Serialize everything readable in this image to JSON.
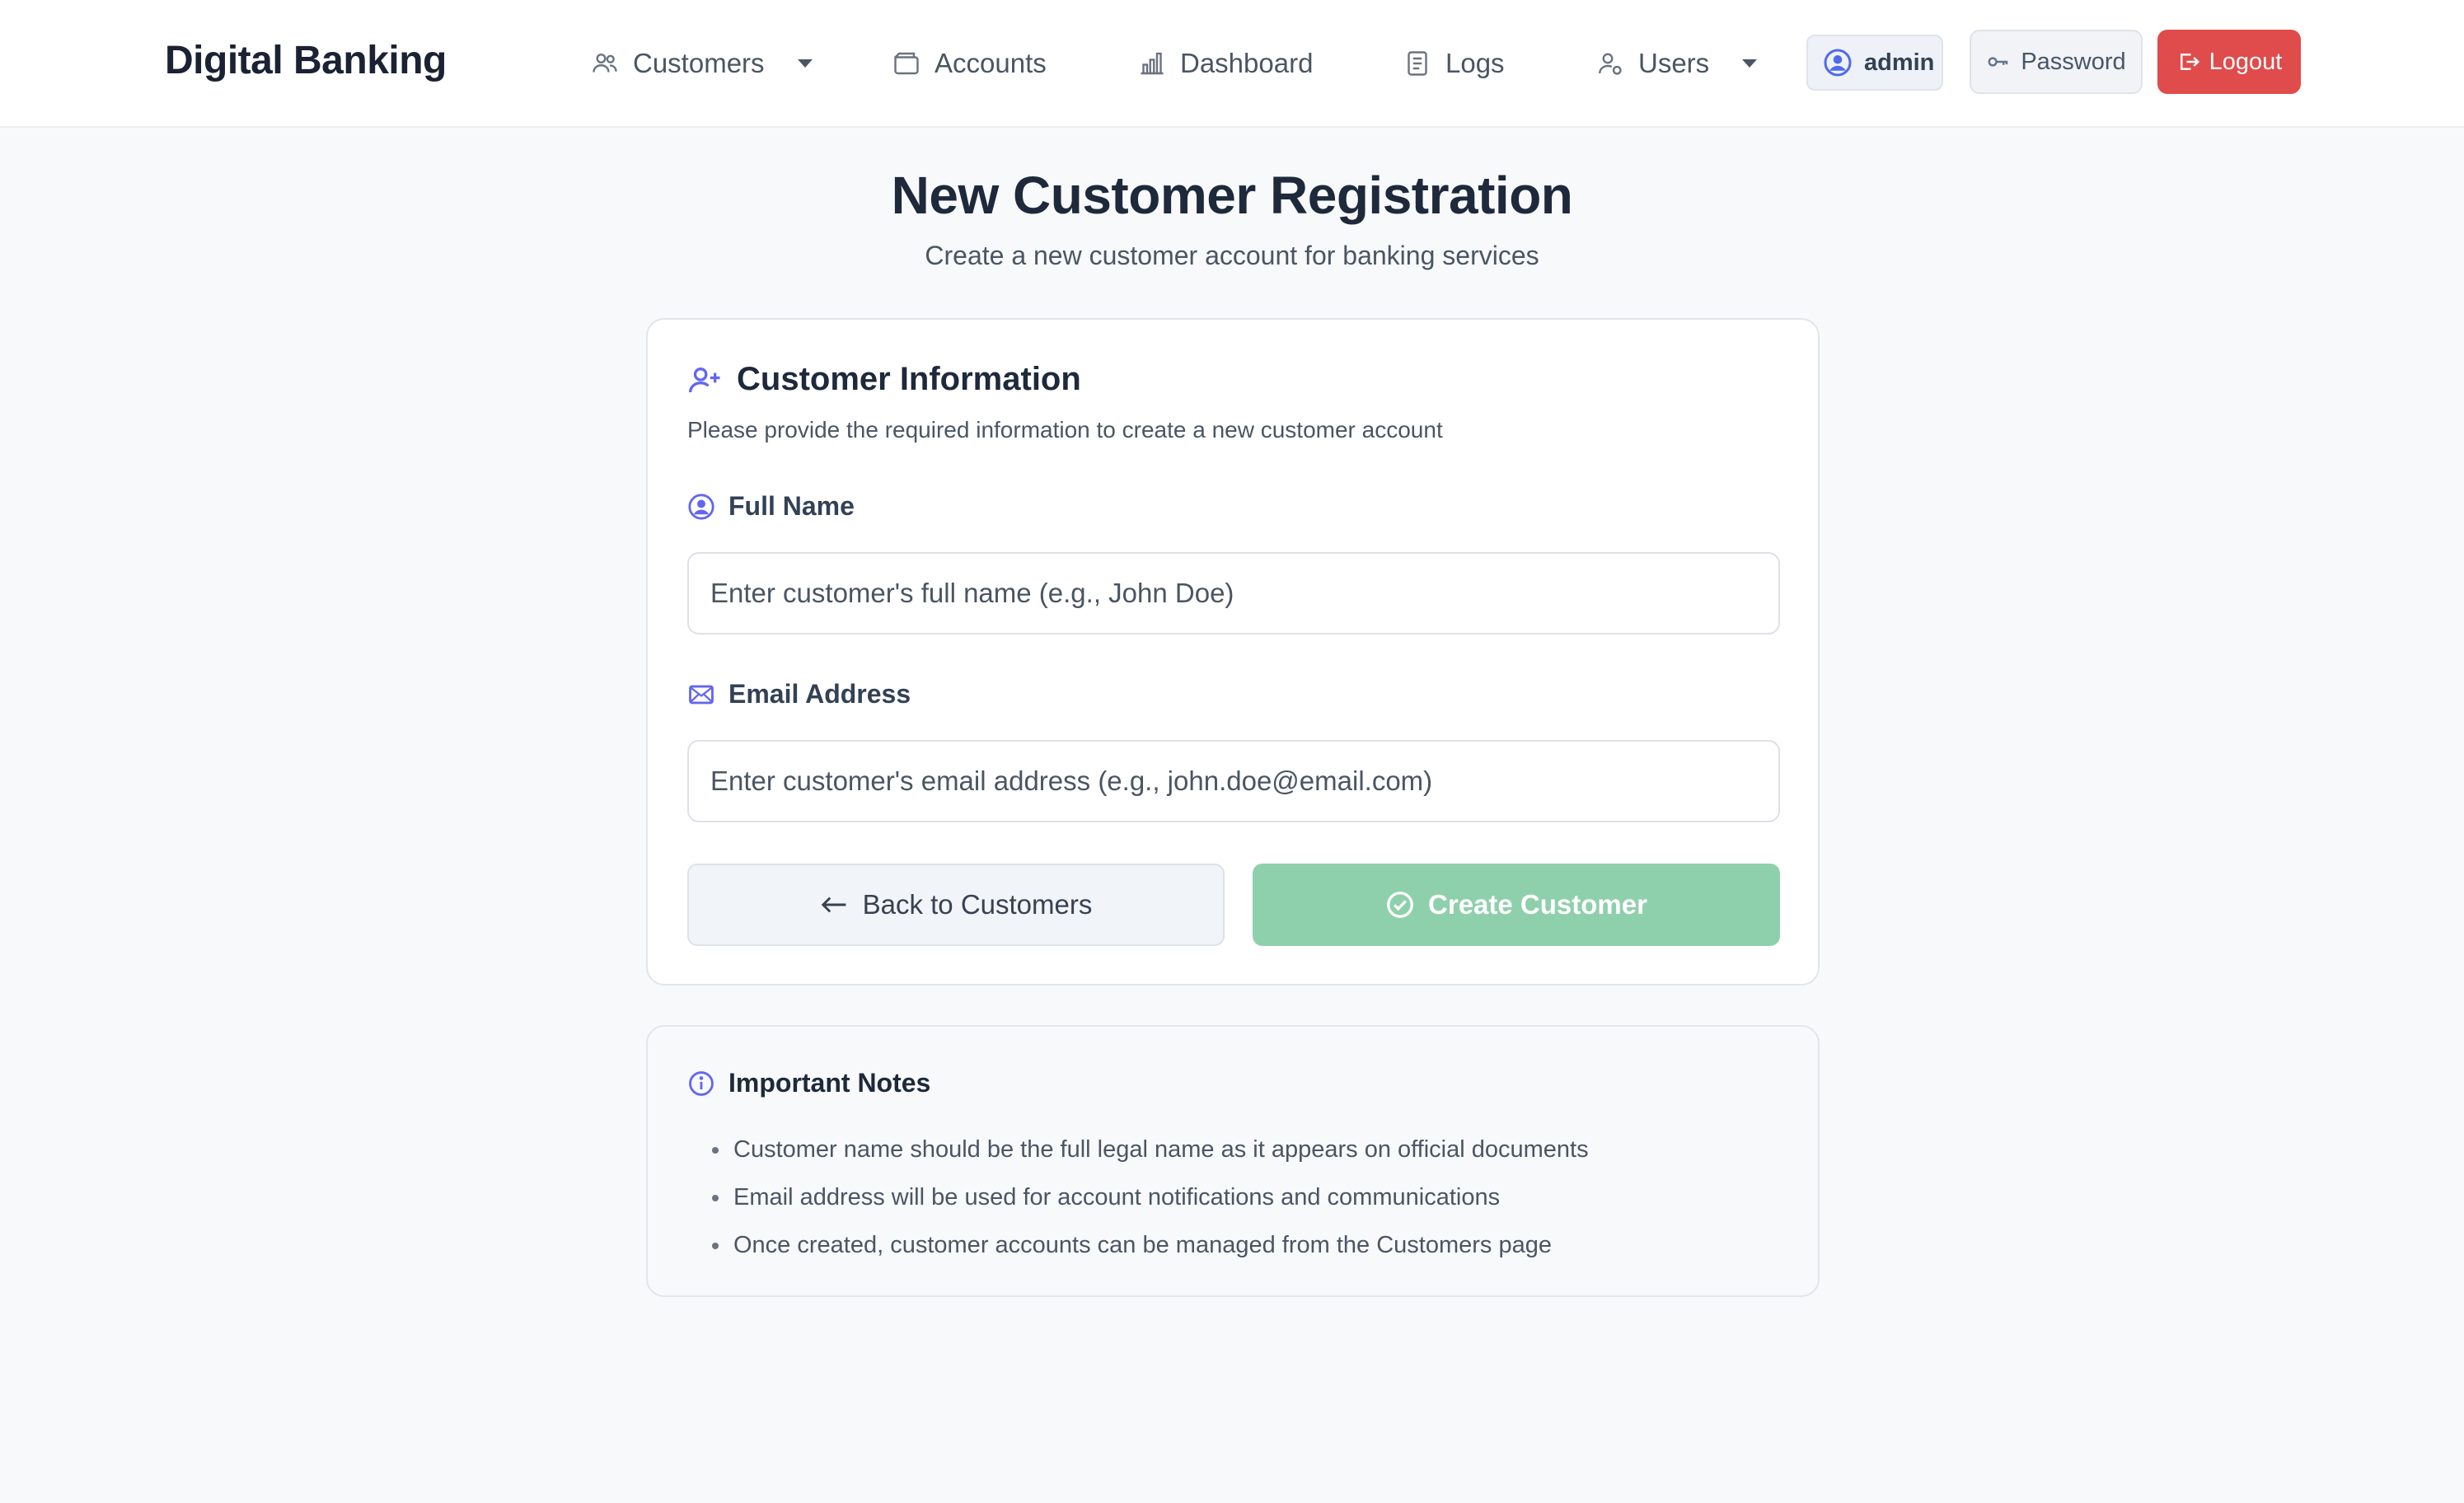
{
  "navbar": {
    "brand": "Digital Banking",
    "items": [
      {
        "label": "Customers",
        "icon": "users-icon",
        "dropdown": true
      },
      {
        "label": "Accounts",
        "icon": "wallet-icon",
        "dropdown": false
      },
      {
        "label": "Dashboard",
        "icon": "bar-chart-icon",
        "dropdown": false
      },
      {
        "label": "Logs",
        "icon": "document-icon",
        "dropdown": false
      },
      {
        "label": "Users",
        "icon": "user-gear-icon",
        "dropdown": true
      }
    ],
    "user": "admin",
    "password_label": "Password",
    "logout_label": "Logout"
  },
  "header": {
    "title": "New Customer Registration",
    "subtitle": "Create a new customer account for banking services"
  },
  "form": {
    "title": "Customer Information",
    "description": "Please provide the required information to create a new customer account",
    "name_label": "Full Name",
    "name_placeholder": "Enter customer's full name (e.g., John Doe)",
    "name_value": "",
    "email_label": "Email Address",
    "email_placeholder": "Enter customer's email address (e.g., john.doe@email.com)",
    "email_value": "",
    "back_label": "Back to Customers",
    "create_label": "Create Customer"
  },
  "notes": {
    "title": "Important Notes",
    "items": [
      "Customer name should be the full legal name as it appears on official documents",
      "Email address will be used for account notifications and communications",
      "Once created, customer accounts can be managed from the Customers page"
    ]
  },
  "colors": {
    "accent": "#6366f1",
    "logout": "#e04b4b",
    "create_disabled": "#8fd0ac",
    "page_bg": "#f8f9fb"
  }
}
